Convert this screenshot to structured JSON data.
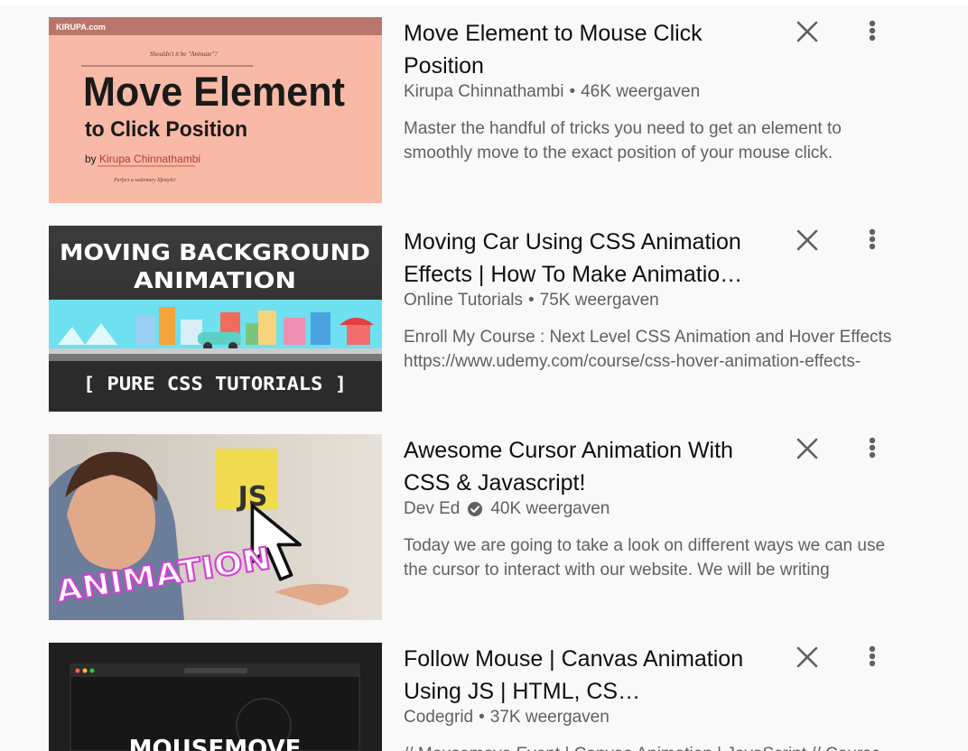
{
  "videos": [
    {
      "title": "Move Element to Mouse Click Position",
      "channel": "Kirupa Chinnathambi",
      "verified": false,
      "views": "46K weergaven",
      "desc_line1": "Master the handful of tricks you need to get an element to",
      "desc_line2": "smoothly move to the exact position of your mouse click.",
      "thumb": {
        "brand": "KIRUPA.com",
        "kicker": "Shouldn't it be \"Animate\"?",
        "big": "Move Element",
        "sub": "to Click Position",
        "by": "by",
        "author": "Kirupa Chinnathambi",
        "tag": "Perfect a sedentary lifestyle!"
      }
    },
    {
      "title": "Moving Car Using CSS Animation Effects | How To Make Animatio…",
      "channel": "Online Tutorials",
      "verified": false,
      "views": "75K weergaven",
      "desc_line1": "Enroll My Course : Next Level CSS Animation and Hover Effects",
      "desc_line2": "https://www.udemy.com/course/css-hover-animation-effects-",
      "thumb": {
        "line1": "MOVING BACKGROUND",
        "line2": "ANIMATION",
        "bottom": "[ PURE CSS TUTORIALS ]"
      }
    },
    {
      "title": "Awesome Cursor Animation With CSS & Javascript!",
      "channel": "Dev Ed",
      "verified": true,
      "views": "40K weergaven",
      "desc_line1": "Today we are going to take a look on different ways we can use",
      "desc_line2": "the cursor to interact with our website. We will be writing",
      "thumb": {
        "badge": "JS",
        "word": "ANIMATION"
      }
    },
    {
      "title": "Follow Mouse | Canvas Animation Using JS | HTML, CS…",
      "channel": "Codegrid",
      "verified": false,
      "views": "37K weergaven",
      "desc_line1": "// Mousemove Event | Canvas Animation | JavaScript // Course",
      "desc_line2": "",
      "thumb": {
        "word": "MOUSEMOVE"
      }
    }
  ],
  "separator": "•",
  "icons": {
    "dismiss": "close-icon",
    "menu": "more-vert-icon",
    "verified": "verified-check-icon"
  },
  "colors": {
    "title": "#0f0f0f",
    "meta": "#606060",
    "background": "#f9f9f9"
  }
}
